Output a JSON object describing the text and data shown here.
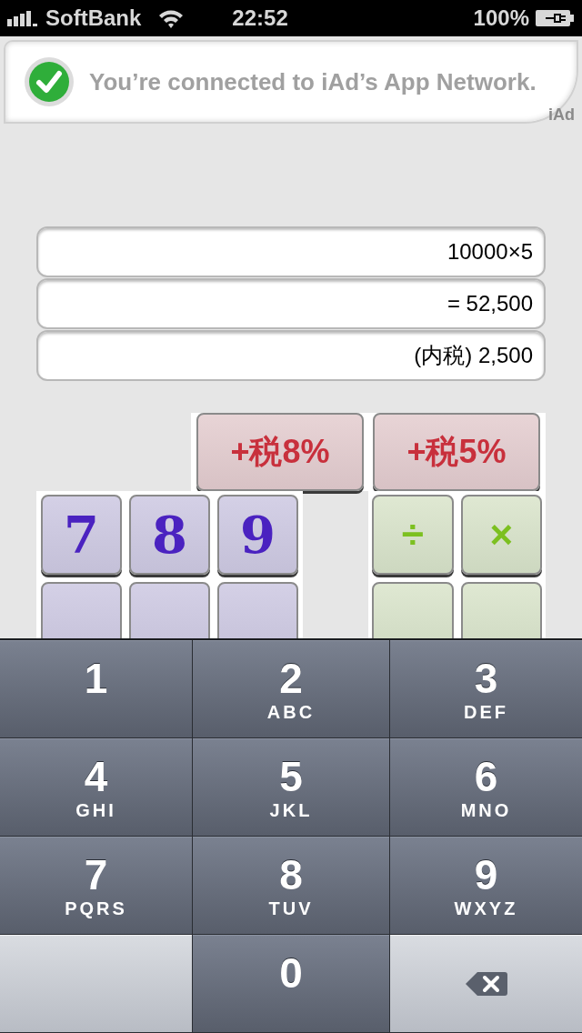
{
  "status_bar": {
    "carrier": "SoftBank",
    "time": "22:52",
    "battery": "100%"
  },
  "ad_banner": {
    "message": "You’re connected to iAd’s App Network.",
    "brand": "iAd"
  },
  "display": [
    "10000×5",
    "= 52,500",
    "(内税) 2,500"
  ],
  "tax_buttons": [
    "+税8%",
    "+税5%"
  ],
  "digit_keys": [
    "7",
    "8",
    "9"
  ],
  "operator_keys": [
    "÷",
    "×"
  ],
  "keypad": [
    {
      "kind": "digit",
      "digit": "1"
    },
    {
      "kind": "digit",
      "digit": "2",
      "letters": "ABC"
    },
    {
      "kind": "digit",
      "digit": "3",
      "letters": "DEF"
    },
    {
      "kind": "digit",
      "digit": "4",
      "letters": "GHI"
    },
    {
      "kind": "digit",
      "digit": "5",
      "letters": "JKL"
    },
    {
      "kind": "digit",
      "digit": "6",
      "letters": "MNO"
    },
    {
      "kind": "digit",
      "digit": "7",
      "letters": "PQRS"
    },
    {
      "kind": "digit",
      "digit": "8",
      "letters": "TUV"
    },
    {
      "kind": "digit",
      "digit": "9",
      "letters": "WXYZ"
    },
    {
      "kind": "blank"
    },
    {
      "kind": "digit",
      "digit": "0"
    },
    {
      "kind": "delete"
    }
  ]
}
